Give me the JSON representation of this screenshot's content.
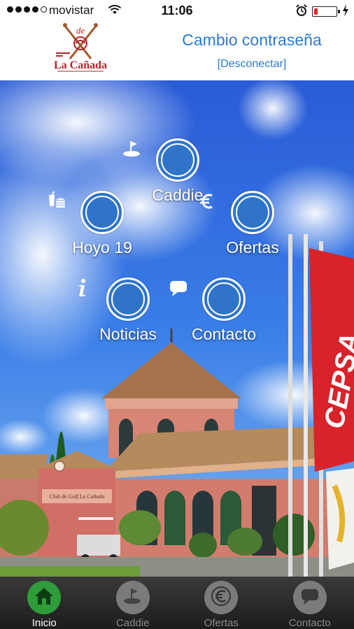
{
  "status_bar": {
    "carrier": "movistar",
    "time": "11:06",
    "battery_level": 0.15,
    "signal_bars": 4,
    "signal_total": 5
  },
  "header": {
    "title": "Cambio contraseña",
    "disconnect_link": "[Desconectar]",
    "logo_text": "La Cañada"
  },
  "menu": {
    "caddie": "Caddie",
    "hoyo19": "Hoyo 19",
    "ofertas": "Ofertas",
    "noticias": "Noticias",
    "contacto": "Contacto"
  },
  "tabs": [
    {
      "label": "Inicio",
      "icon": "home-icon",
      "active": true
    },
    {
      "label": "Caddie",
      "icon": "golf-flag-icon",
      "active": false
    },
    {
      "label": "Ofertas",
      "icon": "euro-icon",
      "active": false
    },
    {
      "label": "Contacto",
      "icon": "chat-bubble-icon",
      "active": false
    }
  ],
  "background": {
    "flag_text": "CEPSA",
    "sign_text": "Club de Golf La Cañada"
  },
  "colors": {
    "accent_blue": "#2a7ad0",
    "menu_circle": "#2f74c9",
    "active_tab": "#2f9c3a",
    "tab_inactive": "#7b7b7b",
    "battery_low": "#e4262b"
  }
}
